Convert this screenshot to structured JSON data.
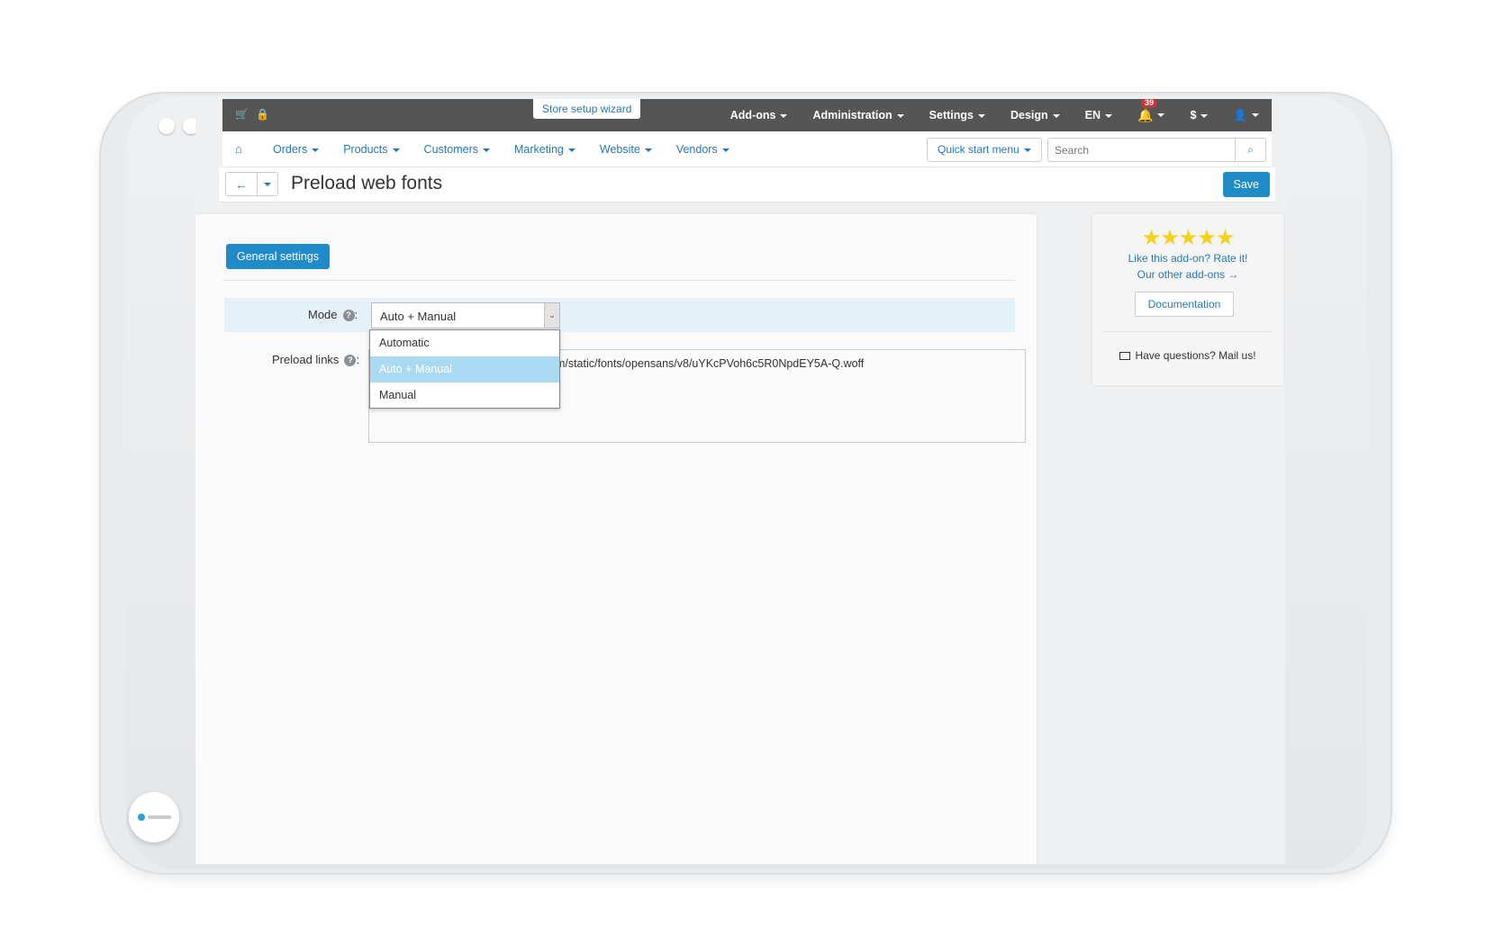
{
  "topbar": {
    "wizard_label": "Store setup wizard",
    "menu": [
      {
        "label": "Add-ons"
      },
      {
        "label": "Administration"
      },
      {
        "label": "Settings"
      },
      {
        "label": "Design"
      },
      {
        "label": "EN"
      }
    ],
    "notification_count": "39",
    "currency_label": "$"
  },
  "subnav": {
    "items": [
      {
        "label": "Orders"
      },
      {
        "label": "Products"
      },
      {
        "label": "Customers"
      },
      {
        "label": "Marketing"
      },
      {
        "label": "Website"
      },
      {
        "label": "Vendors"
      }
    ],
    "quick_menu": "Quick start menu",
    "search_placeholder": "Search"
  },
  "page": {
    "title": "Preload web fonts",
    "save_label": "Save"
  },
  "form": {
    "tab_label": "General settings",
    "mode_label": "Mode",
    "mode_value": "Auto + Manual",
    "mode_options": [
      "Automatic",
      "Auto + Manual",
      "Manual"
    ],
    "preload_label": "Preload links",
    "preload_value": "om/static/fonts/opensans/v8/uYKcPVoh6c5R0NpdEY5A-Q.woff"
  },
  "sidebar": {
    "stars": "★★★★★",
    "rate_text": "Like this add-on? Rate it!",
    "other_text": "Our other add-ons →",
    "doc_label": "Documentation",
    "mail_text": "Have questions? Mail us!"
  },
  "colors": {
    "accent": "#1f8bc9",
    "link": "#2478b5",
    "topbar": "#555555",
    "selected_option": "#a9daf2",
    "star": "#f4d11b"
  }
}
